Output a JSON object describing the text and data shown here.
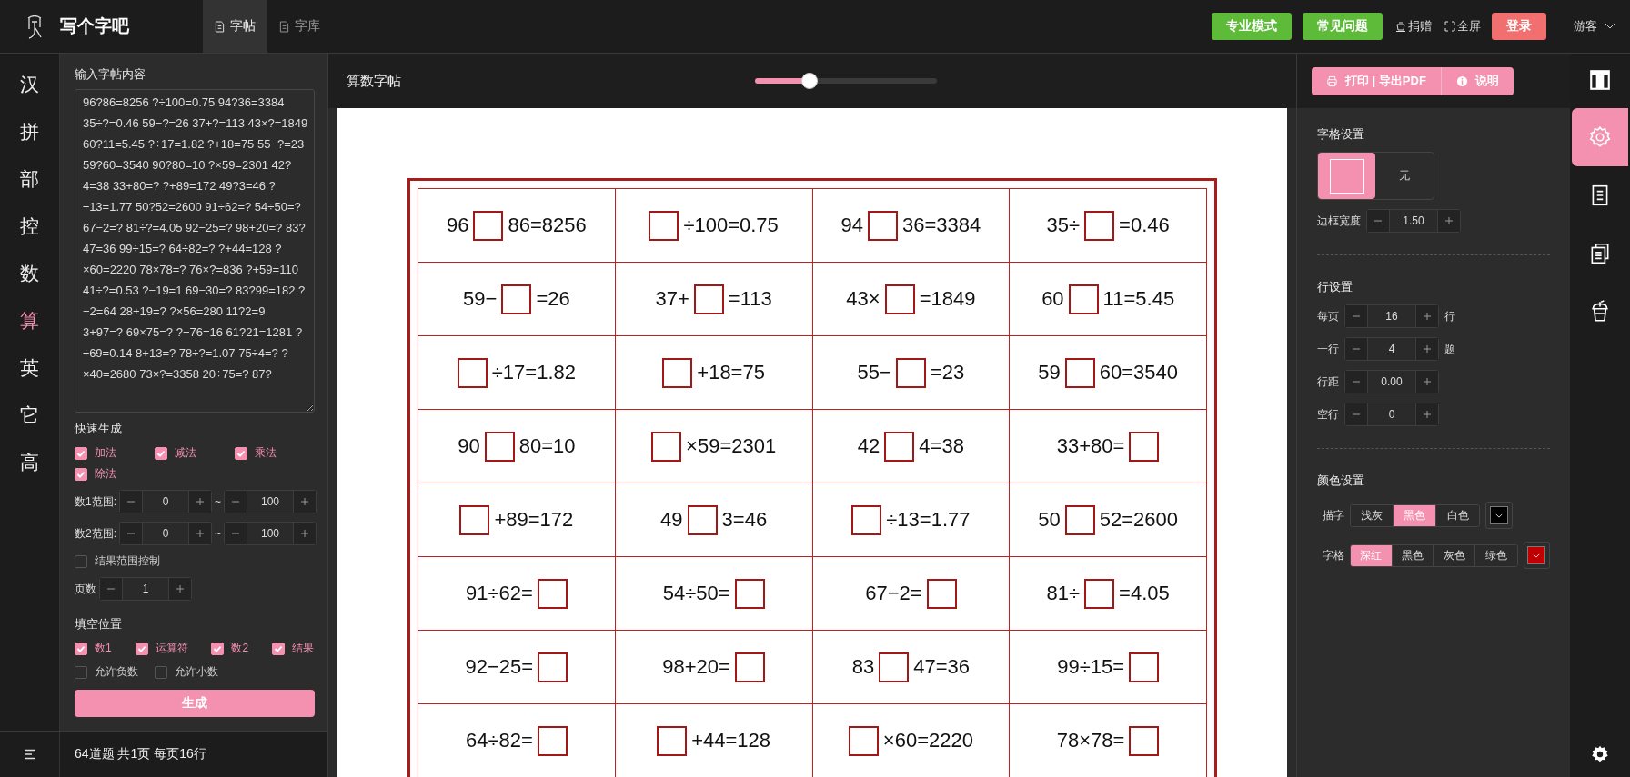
{
  "header": {
    "logo_text": "写个字吧",
    "tabs": [
      {
        "label": "字帖",
        "selected": true
      },
      {
        "label": "字库",
        "selected": false
      }
    ],
    "actions": [
      {
        "label": "专业模式",
        "kind": "green"
      },
      {
        "label": "常见问题",
        "kind": "green"
      },
      {
        "label": "捐赠",
        "kind": "donate"
      },
      {
        "label": "全屏",
        "kind": "fullscreen"
      },
      {
        "label": "登录",
        "kind": "primary"
      }
    ],
    "user": "游客"
  },
  "nav": [
    {
      "label": "汉",
      "selected": false
    },
    {
      "label": "拼",
      "selected": false
    },
    {
      "label": "部",
      "selected": false
    },
    {
      "label": "控",
      "selected": false
    },
    {
      "label": "数",
      "selected": false
    },
    {
      "label": "算",
      "selected": true
    },
    {
      "label": "英",
      "selected": false
    },
    {
      "label": "它",
      "selected": false
    },
    {
      "label": "高",
      "selected": false
    }
  ],
  "input_panel": {
    "title": "输入字帖内容",
    "content": "96?86=8256 ?÷100=0.75 94?36=3384 35÷?=0.46 59−?=26 37+?=113 43×?=1849 60?11=5.45 ?÷17=1.82 ?+18=75 55−?=23 59?60=3540 90?80=10 ?×59=2301 42?4=38 33+80=? ?+89=172 49?3=46 ?÷13=1.77 50?52=2600 91÷62=? 54÷50=? 67−2=? 81÷?=4.05 92−25=? 98+20=? 83?47=36 99÷15=? 64÷82=? ?+44=128 ?×60=2220 78×78=? 76×?=836 ?+59=110 41÷?=0.53 ?−19=1 69−30=? 83?99=182 ?−2=64 28+19=? ?×56=280 11?2=9 3+97=? 69×75=? ?−76=16 61?21=1281 ?÷69=0.14 8+13=? 78÷?=1.07 75÷4=? ?×40=2680 73×?=3358 20÷75=? 87?",
    "quick_title": "快速生成",
    "operations": [
      {
        "label": "加法",
        "checked": true
      },
      {
        "label": "减法",
        "checked": true
      },
      {
        "label": "乘法",
        "checked": true
      },
      {
        "label": "除法",
        "checked": true
      }
    ],
    "ranges": [
      {
        "label": "数1范围:",
        "min": "0",
        "separator": "~",
        "max": "100"
      },
      {
        "label": "数2范围:",
        "min": "0",
        "separator": "~",
        "max": "100"
      }
    ],
    "result_range": {
      "label": "结果范围控制",
      "checked": false
    },
    "pages": {
      "label": "页数",
      "value": "1"
    },
    "blank_title": "填空位置",
    "blank_positions": [
      {
        "label": "数1",
        "checked": true
      },
      {
        "label": "运算符",
        "checked": true
      },
      {
        "label": "数2",
        "checked": true
      },
      {
        "label": "结果",
        "checked": true
      }
    ],
    "options": [
      {
        "label": "允许负数",
        "checked": false
      },
      {
        "label": "允许小数",
        "checked": false
      }
    ],
    "generate": "生成"
  },
  "status": "64道题 共1页 每页16行",
  "sheet": {
    "title": "算数字帖",
    "zoom": {
      "level": 0.3
    },
    "rows": [
      [
        {
          "before": "96",
          "after": "86=8256"
        },
        {
          "after": "÷100=0.75"
        },
        {
          "before": "94",
          "after": "36=3384"
        },
        {
          "before": "35÷",
          "after": "=0.46"
        }
      ],
      [
        {
          "before": "59−",
          "after": "=26"
        },
        {
          "before": "37+",
          "after": "=113"
        },
        {
          "before": "43×",
          "after": "=1849"
        },
        {
          "before": "60",
          "after": "11=5.45"
        }
      ],
      [
        {
          "after": "÷17=1.82"
        },
        {
          "after": "+18=75"
        },
        {
          "before": "55−",
          "after": "=23"
        },
        {
          "before": "59",
          "after": "60=3540"
        }
      ],
      [
        {
          "before": "90",
          "after": "80=10"
        },
        {
          "after": "×59=2301"
        },
        {
          "before": "42",
          "after": "4=38"
        },
        {
          "before": "33+80="
        }
      ],
      [
        {
          "after": "+89=172"
        },
        {
          "before": "49",
          "after": "3=46"
        },
        {
          "after": "÷13=1.77"
        },
        {
          "before": "50",
          "after": "52=2600"
        }
      ],
      [
        {
          "before": "91÷62="
        },
        {
          "before": "54÷50="
        },
        {
          "before": "67−2="
        },
        {
          "before": "81÷",
          "after": "=4.05"
        }
      ],
      [
        {
          "before": "92−25="
        },
        {
          "before": "98+20="
        },
        {
          "before": "83",
          "after": "47=36"
        },
        {
          "before": "99÷15="
        }
      ],
      [
        {
          "before": "64÷82="
        },
        {
          "after": "+44=128"
        },
        {
          "after": "×60=2220"
        },
        {
          "before": "78×78="
        }
      ]
    ]
  },
  "settings": {
    "print_button": "打印 | 导出PDF",
    "help_button": "说明",
    "side_tabs": [
      {
        "kind": "layout",
        "selected": false
      },
      {
        "kind": "gear",
        "selected": true
      },
      {
        "kind": "document",
        "selected": false
      },
      {
        "kind": "copy",
        "selected": false
      },
      {
        "kind": "cup",
        "selected": false
      }
    ],
    "grid": {
      "title": "字格设置",
      "styles": [
        {
          "kind": "square",
          "selected": true
        },
        {
          "kind": "none",
          "label": "无",
          "selected": false
        }
      ],
      "border": {
        "label": "边框宽度",
        "value": "1.50"
      }
    },
    "rows": {
      "title": "行设置",
      "fields": [
        {
          "label": "每页",
          "value": "16",
          "unit": "行"
        },
        {
          "label": "一行",
          "value": "4",
          "unit": "题"
        },
        {
          "label": "行距",
          "value": "0.00"
        },
        {
          "label": "空行",
          "value": "0"
        }
      ]
    },
    "colors": {
      "title": "颜色设置",
      "groups": [
        {
          "label": "描字",
          "options": [
            {
              "label": "浅灰",
              "selected": false
            },
            {
              "label": "黑色",
              "selected": true
            },
            {
              "label": "白色",
              "selected": false
            }
          ],
          "color": "#000000"
        },
        {
          "label": "字格",
          "options": [
            {
              "label": "深红",
              "selected": true
            },
            {
              "label": "黑色",
              "selected": false
            },
            {
              "label": "灰色",
              "selected": false
            },
            {
              "label": "绿色",
              "selected": false
            }
          ],
          "color": "#c00000"
        }
      ]
    }
  }
}
